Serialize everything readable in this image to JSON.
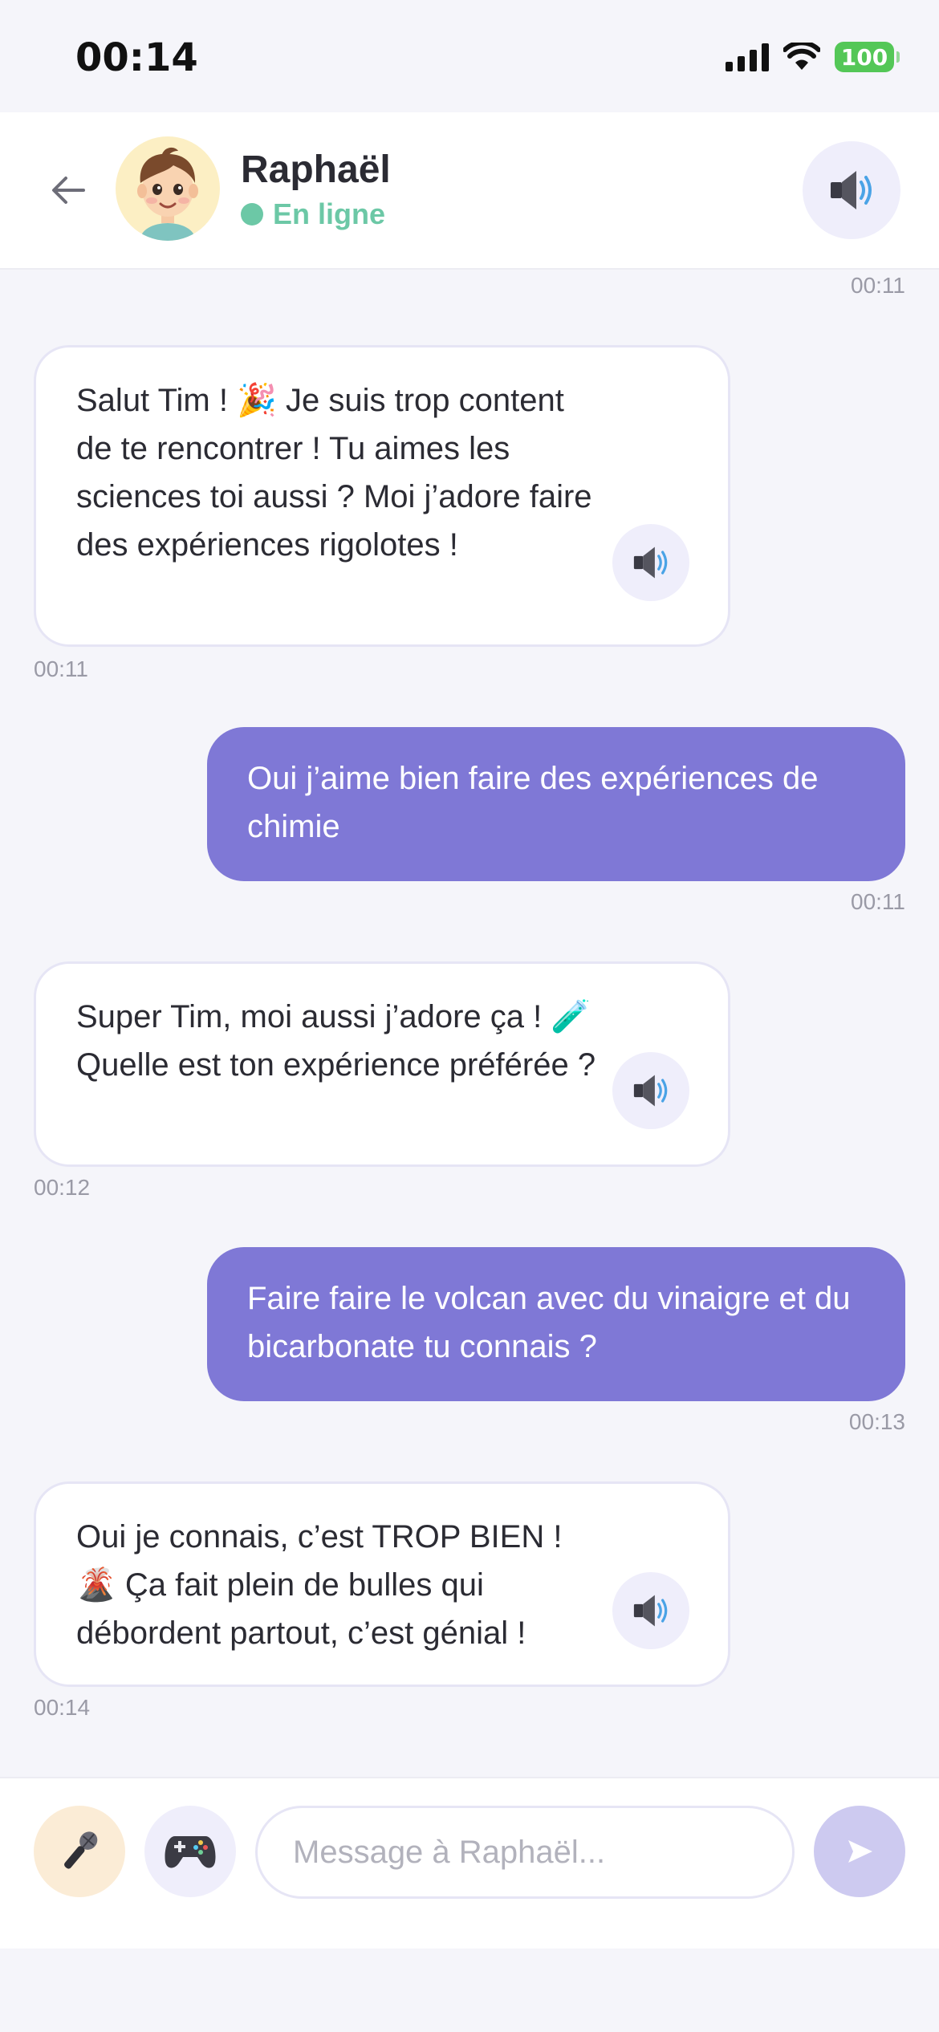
{
  "status_bar": {
    "time": "00:14",
    "battery": "100"
  },
  "header": {
    "name": "Raphaël",
    "status": "En ligne",
    "icons": {
      "back": "arrow-left-icon",
      "avatar": "boy-avatar",
      "speaker": "speaker-icon"
    }
  },
  "messages": [
    {
      "type": "timestamp",
      "time": "00:11"
    },
    {
      "from": "contact",
      "text": "Salut Tim ! 🎉 Je suis trop content de te rencontrer ! Tu aimes les sciences toi aussi ? Moi j’adore faire des expériences rigolotes !",
      "time": "00:11"
    },
    {
      "from": "me",
      "text": "Oui j’aime bien faire des expériences de chimie",
      "time": "00:11"
    },
    {
      "from": "contact",
      "text": "Super Tim, moi aussi j’adore ça ! 🧪 Quelle est ton expérience préférée ?",
      "time": "00:12"
    },
    {
      "from": "me",
      "text": "Faire faire le volcan avec du vinaigre et du bicarbonate tu connais ?",
      "time": "00:13"
    },
    {
      "from": "contact",
      "text": "Oui je connais, c’est TROP BIEN ! 🌋 Ça fait plein de bulles qui débordent partout, c’est génial !",
      "time": "00:14"
    }
  ],
  "composer": {
    "placeholder": "Message à Raphaël...",
    "icons": {
      "mic": "microphone-icon",
      "game": "gamepad-icon",
      "send": "send-icon"
    }
  },
  "colors": {
    "accent": "#7f78d6",
    "online": "#6cc8a6",
    "background": "#f5f5fa",
    "battery": "#54c757"
  }
}
